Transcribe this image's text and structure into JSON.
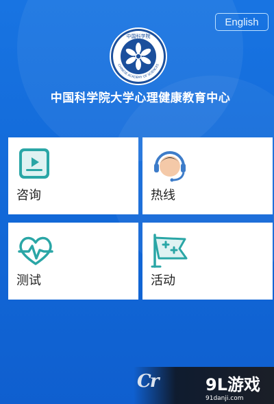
{
  "header": {
    "language_button": "English",
    "logo_text_top": "中国科学院",
    "logo_text_ring": "CHINESE ACADEMY OF SCIENCES",
    "title": "中国科学院大学心理健康教育中心"
  },
  "menu": [
    {
      "label": "咨询",
      "icon": "video-play-icon"
    },
    {
      "label": "热线",
      "icon": "headset-agent-icon"
    },
    {
      "label": "测试",
      "icon": "heart-pulse-icon"
    },
    {
      "label": "活动",
      "icon": "flag-plus-icon"
    }
  ],
  "watermark": {
    "brand": "9L游戏",
    "site": "91danji.com",
    "brand_bottom": "9L游戏",
    "site_bottom": "91danji.com",
    "cr_text": "Cr"
  },
  "colors": {
    "background": "#1469d6",
    "card": "#ffffff",
    "icon_teal": "#2aa6a6",
    "icon_blue": "#3d7cc9"
  }
}
